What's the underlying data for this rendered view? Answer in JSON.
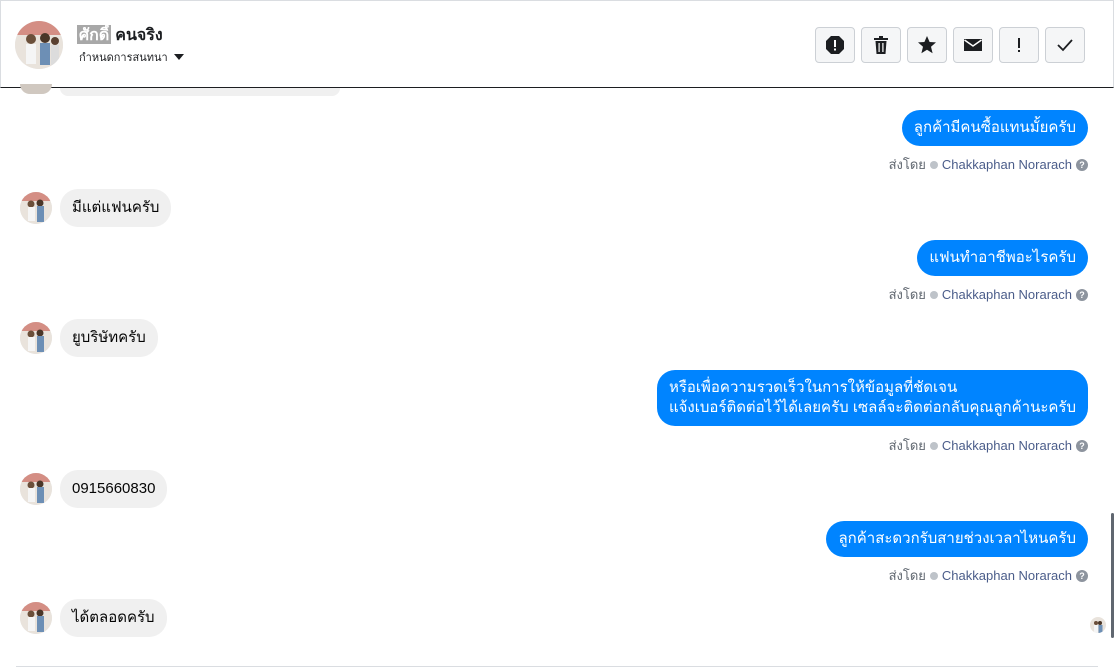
{
  "header": {
    "name_first": "ศักดิ์",
    "name_last": "คนจริง",
    "assign_label": "กำหนดการสนทนา",
    "actions": [
      {
        "name": "report-spam-icon"
      },
      {
        "name": "trash-icon"
      },
      {
        "name": "star-icon"
      },
      {
        "name": "envelope-icon"
      },
      {
        "name": "exclamation-icon"
      },
      {
        "name": "checkmark-icon"
      }
    ]
  },
  "messages": {
    "out1": "ลูกค้ามีคนซื้อแทนมั้ยครับ",
    "in1": "มีแต่แฟนครับ",
    "out2": "แฟนทำอาชีพอะไรครับ",
    "in2": "ยูบริษัทครับ",
    "out3_line1": "หรือเพื่อความรวดเร็วในการให้ข้อมูลที่ชัดเจน",
    "out3_line2": "แจ้งเบอร์ติดต่อไว้ได้เลยครับ เซลล์จะติดต่อกลับคุณลูกค้านะครับ",
    "in3": "0915660830",
    "out4": "ลูกค้าสะดวกรับสายช่วงเวลาไหนครับ",
    "in4": "ได้ตลอดครับ"
  },
  "sent_by": {
    "label": "ส่งโดย",
    "agent": "Chakkaphan Norarach"
  },
  "colors": {
    "outgoing_bubble": "#0084ff",
    "incoming_bubble": "#f0f0f0"
  }
}
